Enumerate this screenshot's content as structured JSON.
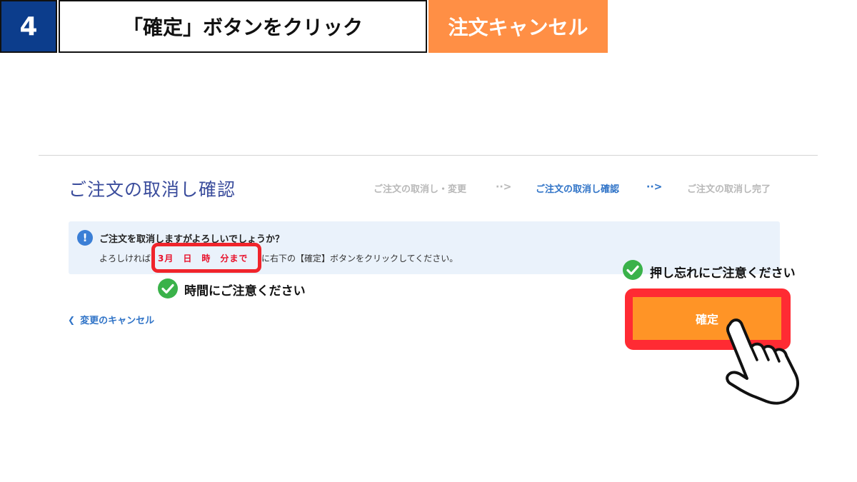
{
  "banner": {
    "step_number": "4",
    "step_title": "「確定」ボタンをクリック",
    "step_tag": "注文キャンセル"
  },
  "page": {
    "title": "ご注文の取消し確認",
    "progress": {
      "steps": [
        "ご注文の取消し・変更",
        "ご注文の取消し確認",
        "ご注文の取消し完了"
      ],
      "arrow": "··>",
      "active_index": 1
    },
    "notice": {
      "heading": "ご注文を取消しますがよろしいでしょうか？",
      "line_prefix": "よろしければ",
      "date_text": "3月　日　時　分まで",
      "line_suffix": "に右下の【確定】ボタンをクリックしてください。"
    },
    "cancel_link": "変更のキャンセル",
    "confirm_button": "確定"
  },
  "annotations": {
    "time_note": "時間にご注意ください",
    "confirm_note": "押し忘れにご注意ください"
  },
  "colors": {
    "banner_blue": "#0c3d8c",
    "banner_orange": "#ff8f45",
    "highlight_red": "#ff2b33",
    "confirm_orange": "#ff9426",
    "link_blue": "#2f73c7",
    "check_green": "#3ab24a"
  }
}
